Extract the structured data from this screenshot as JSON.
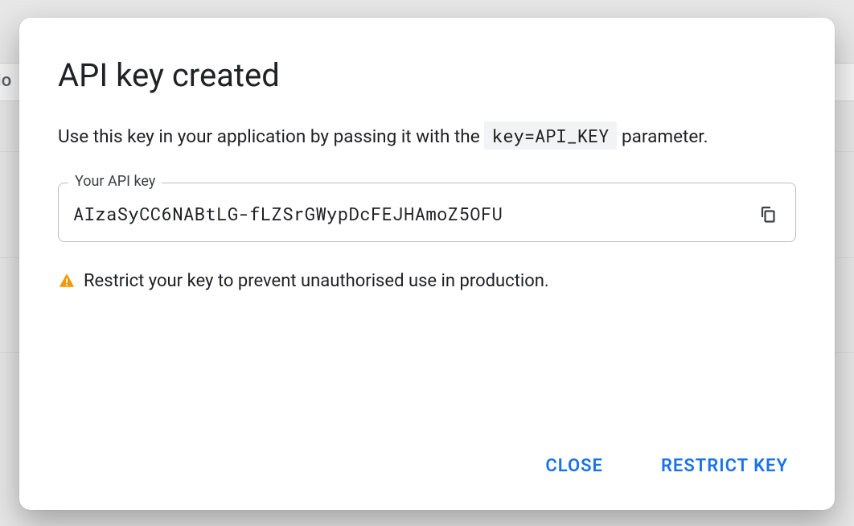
{
  "dialog": {
    "title": "API key created",
    "description_prefix": "Use this key in your application by passing it with the ",
    "description_code": "key=API_KEY",
    "description_suffix": " parameter.",
    "field_legend": "Your API key",
    "api_key_value": "AIzaSyCC6NABtLG-fLZSrGWypDcFEJHAmoZ5OFU",
    "copy_icon": "copy-icon",
    "warning_icon": "warning-icon",
    "warning_text": "Restrict your key to prevent unauthorised use in production.",
    "actions": {
      "close": "CLOSE",
      "restrict": "RESTRICT KEY"
    }
  },
  "background": {
    "partial_text": "io"
  },
  "colors": {
    "accent": "#1a73e8",
    "warning": "#f29900"
  }
}
